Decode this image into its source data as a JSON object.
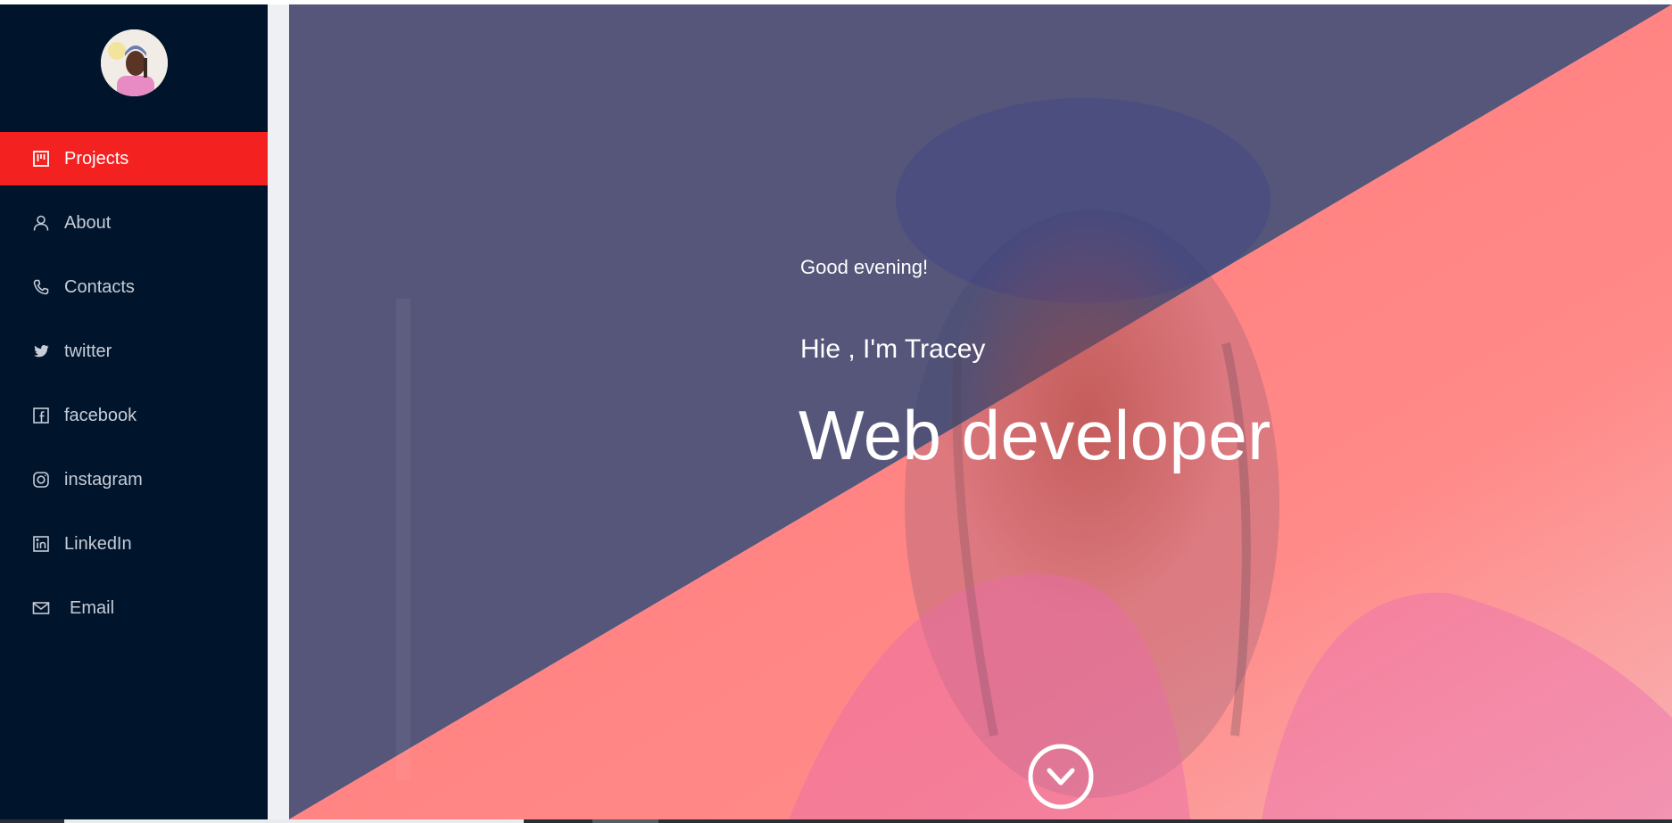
{
  "sidebar": {
    "avatar_alt": "Tracey avatar",
    "items": [
      {
        "label": "Projects",
        "icon": "projects-board-icon",
        "active": true
      },
      {
        "label": "About",
        "icon": "user-icon"
      },
      {
        "label": "Contacts",
        "icon": "phone-icon"
      },
      {
        "label": "twitter",
        "icon": "twitter-icon"
      },
      {
        "label": "facebook",
        "icon": "facebook-icon"
      },
      {
        "label": "instagram",
        "icon": "instagram-icon"
      },
      {
        "label": "LinkedIn",
        "icon": "linkedin-icon"
      },
      {
        "label": "Email",
        "icon": "mail-icon"
      }
    ]
  },
  "hero": {
    "greeting": "Good evening!",
    "intro": "Hie , I'm Tracey",
    "role": "Web developer",
    "scroll_icon": "chevron-down-circle-icon"
  },
  "colors": {
    "sidebar_bg": "#00142b",
    "active_item": "#f42121",
    "hero_overlay_dark": "#55567a",
    "hero_overlay_coral": "#ff7a78",
    "text_light": "#ffffff"
  }
}
